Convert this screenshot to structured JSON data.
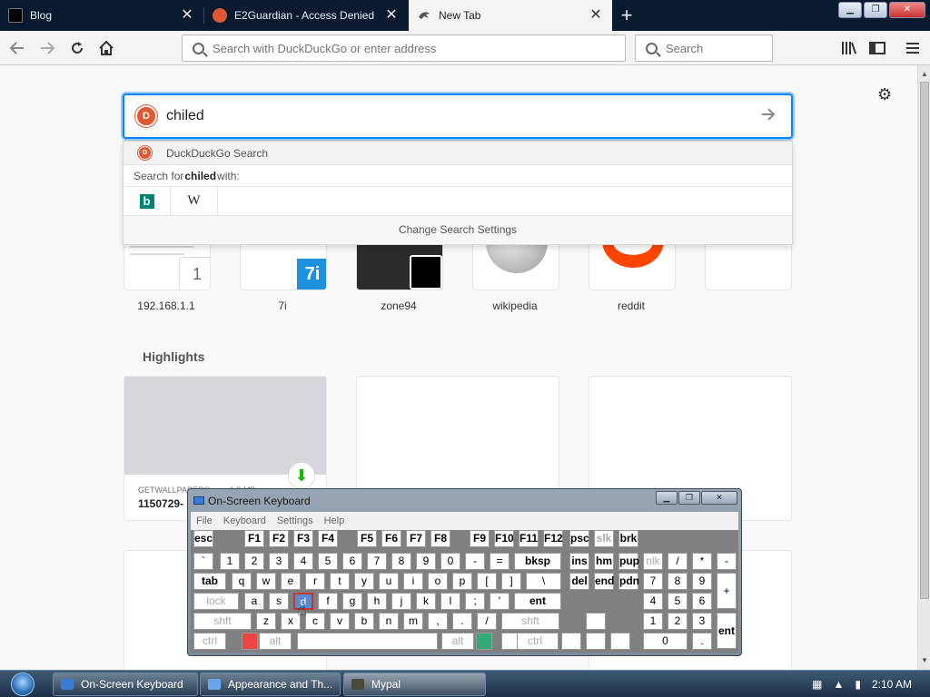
{
  "tabs": [
    {
      "title": "Blog",
      "icon": "terminal-icon"
    },
    {
      "title": "E2Guardian - Access Denied",
      "icon": "duckduckgo-icon"
    },
    {
      "title": "New Tab",
      "icon": "bird-icon"
    }
  ],
  "nav": {
    "url_placeholder": "Search with DuckDuckGo or enter address",
    "search_placeholder": "Search"
  },
  "search": {
    "query": "chiled",
    "engine_label": "DuckDuckGo Search",
    "search_for_prefix": "Search for ",
    "search_for_term": "chiled",
    "search_for_suffix": " with:",
    "engines": [
      "b",
      "W"
    ],
    "change_settings": "Change Search Settings"
  },
  "top_sites": [
    {
      "label": "192.168.1.1",
      "badge": "1"
    },
    {
      "label": "7i",
      "badge": "7i"
    },
    {
      "label": "zone94",
      "badge": ""
    },
    {
      "label": "wikipedia",
      "badge": ""
    },
    {
      "label": "reddit",
      "badge": ""
    }
  ],
  "highlights": {
    "title": "Highlights",
    "card1_source": "GETWALLPAPERS",
    "card1_meta": "1.5 MB",
    "card1_title": "1150729-"
  },
  "osk": {
    "title": "On-Screen Keyboard",
    "menu": [
      "File",
      "Keyboard",
      "Settings",
      "Help"
    ],
    "rows": [
      [
        "esc",
        "F1",
        "F2",
        "F3",
        "F4",
        "F5",
        "F6",
        "F7",
        "F8",
        "F9",
        "F10",
        "F11",
        "F12",
        "psc",
        "slk",
        "brk"
      ],
      [
        "`",
        "1",
        "2",
        "3",
        "4",
        "5",
        "6",
        "7",
        "8",
        "9",
        "0",
        "-",
        "=",
        "bksp",
        "ins",
        "hm",
        "pup",
        "nlk",
        "/",
        "*",
        "-"
      ],
      [
        "tab",
        "q",
        "w",
        "e",
        "r",
        "t",
        "y",
        "u",
        "i",
        "o",
        "p",
        "[",
        "]",
        "\\",
        "del",
        "end",
        "pdn",
        "7",
        "8",
        "9",
        "+"
      ],
      [
        "lock",
        "a",
        "s",
        "d",
        "f",
        "g",
        "h",
        "j",
        "k",
        "l",
        ";",
        "'",
        "ent",
        "4",
        "5",
        "6"
      ],
      [
        "shft",
        "z",
        "x",
        "c",
        "v",
        "b",
        "n",
        "m",
        ",",
        ".",
        "/",
        "shft",
        "1",
        "2",
        "3",
        "ent"
      ],
      [
        "ctrl",
        "alt",
        "alt",
        "ctrl",
        "0",
        "."
      ]
    ]
  },
  "taskbar": {
    "items": [
      "On-Screen Keyboard",
      "Appearance and Th...",
      "Mypal"
    ],
    "clock": "2:10 AM"
  }
}
